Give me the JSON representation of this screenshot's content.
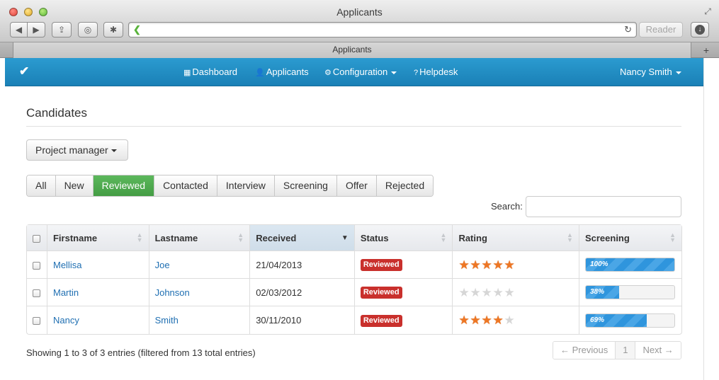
{
  "window": {
    "title": "Applicants"
  },
  "toolbar": {
    "back": "◀",
    "forward": "▶",
    "reader_label": "Reader",
    "address_value": ""
  },
  "tabs": [
    {
      "label": "Applicants"
    }
  ],
  "navbar": {
    "brand": "✔",
    "items": [
      {
        "label": "Dashboard",
        "icon": "grid-icon"
      },
      {
        "label": "Applicants",
        "icon": "user-icon"
      },
      {
        "label": "Configuration",
        "icon": "gear-icon"
      },
      {
        "label": "Helpdesk",
        "icon": "help-icon"
      }
    ],
    "user": "Nancy Smith",
    "color": "#1f8cc3"
  },
  "page": {
    "title": "Candidates",
    "project_dropdown": "Project manager",
    "filters": [
      "All",
      "New",
      "Reviewed",
      "Contacted",
      "Interview",
      "Screening",
      "Offer",
      "Rejected"
    ],
    "active_filter": "Reviewed",
    "search_label": "Search:",
    "search_value": ""
  },
  "table": {
    "columns": [
      "Firstname",
      "Lastname",
      "Received",
      "Status",
      "Rating",
      "Screening"
    ],
    "sorted_column": "Received",
    "rows": [
      {
        "firstname": "Mellisa",
        "lastname": "Joe",
        "received": "21/04/2013",
        "status": "Reviewed",
        "rating": 5,
        "screening": 100,
        "screening_label": "100%"
      },
      {
        "firstname": "Martin",
        "lastname": "Johnson",
        "received": "02/03/2012",
        "status": "Reviewed",
        "rating": 0,
        "screening": 38,
        "screening_label": "38%"
      },
      {
        "firstname": "Nancy",
        "lastname": "Smith",
        "received": "30/11/2010",
        "status": "Reviewed",
        "rating": 4,
        "screening": 69,
        "screening_label": "69%"
      }
    ]
  },
  "footer": {
    "info": "Showing 1 to 3 of 3 entries (filtered from 13 total entries)",
    "prev": "← Previous",
    "page": "1",
    "next": "Next →"
  },
  "colors": {
    "accent_green": "#5cb85c",
    "status_red": "#c9302c",
    "star_orange": "#ee7623",
    "link_blue": "#1f6fb2"
  }
}
